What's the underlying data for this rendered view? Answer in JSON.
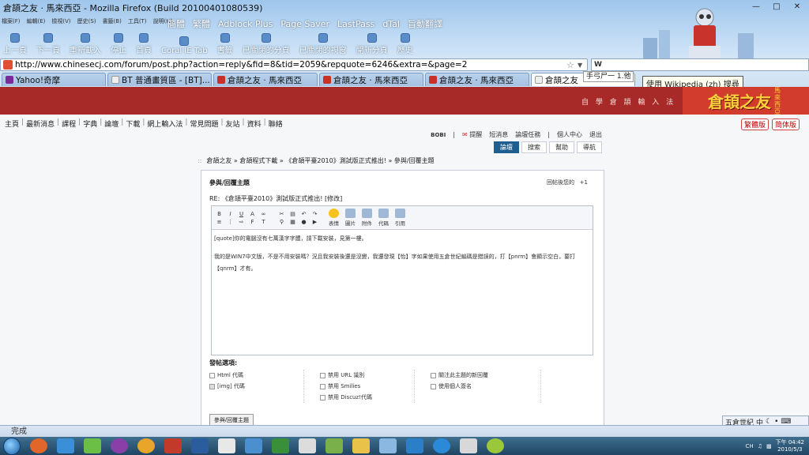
{
  "window": {
    "title": "倉頡之友 · 馬來西亞 - Mozilla Firefox (Build 20100401080539)"
  },
  "menubar": [
    "檔案(F)",
    "編輯(E)",
    "檢視(V)",
    "歷史(S)",
    "書籤(B)",
    "工具(T)",
    "說明(H)"
  ],
  "toolbar2": [
    "簡體",
    "繁體",
    "Adblock Plus",
    "Page Saver",
    "LastPass",
    "dTal",
    "旨動翻譯"
  ],
  "nav": {
    "back": "上一頁",
    "forward": "下一頁",
    "reload": "重新載入",
    "stop": "停止",
    "home": "首頁",
    "coral": "Coral IE Tab",
    "bookmarks": "書籤",
    "closed_tabs": "已關閉的分頁",
    "closed_windows": "已關閉的視窗",
    "new_tab": "開新分頁",
    "history": "歷史"
  },
  "url": "http://www.chinesecj.com/forum/post.php?action=reply&fid=8&tid=2059&repquote=6246&extra=&page=2",
  "search": {
    "value": "",
    "engine": "W",
    "suggest_text": "手弓尸一 1.他",
    "tooltip": "使用 Wikipedia (zh) 搜尋"
  },
  "tabs": [
    {
      "label": "Yahoo!奇摩",
      "icon": "yahoo"
    },
    {
      "label": "BT 普通畫質區 - [BT]...",
      "icon": "page"
    },
    {
      "label": "倉頡之友 · 馬來西亞",
      "icon": "cj"
    },
    {
      "label": "倉頡之友 · 馬來西亞",
      "icon": "cj"
    },
    {
      "label": "倉頡之友 · 馬來西亞",
      "icon": "cj"
    },
    {
      "label": "倉頡之友",
      "icon": "page",
      "active": true
    }
  ],
  "banner": {
    "slogan": "自 學 倉 頡 輸 入 法",
    "logo_main": "倉頡之友",
    "logo_sub": "馬來西亞"
  },
  "mainnav": [
    "主頁",
    "最新消息",
    "課程",
    "字典",
    "論壇",
    "下載",
    "網上輸入法",
    "常見問題",
    "友站",
    "資料",
    "聯絡"
  ],
  "versions": [
    "繁體版",
    "简体版"
  ],
  "userbar": {
    "user": "BOBI",
    "items": [
      "提醒",
      "短消息",
      "論壇任務",
      "個人中心",
      "退出"
    ]
  },
  "subtabs": [
    {
      "label": "論壇",
      "active": true
    },
    {
      "label": "搜索"
    },
    {
      "label": "幫助"
    },
    {
      "label": "導航"
    }
  ],
  "breadcrumb": "倉頡之友 » 倉頡程式下載 » 《倉頡平臺2010》測試版正式推出! » 參與/回覆主題",
  "post": {
    "heading": "參與/回覆主題",
    "reply_link": "回帖後您的",
    "reply_points": "+1",
    "subject": "RE: 《倉頡平臺2010》測試版正式推出!  [修改]",
    "editor_tools": [
      "表情",
      "圖片",
      "附件",
      "代碼",
      "引用"
    ],
    "body_line1": "[quote]你的電腦沒有七萬漢字字體，請下載安裝，見第一樓。",
    "body_line2": "我的是WIN7中文版，不是不用安裝嗎？況且我安裝後還是沒變，我還發現【怡】字如果使用五倉世紀編碼是錯誤的，打【pnrm】會顯示空白，要打【qnrm】才有。",
    "options_title": "發帖選項:",
    "options_col1": [
      "Html 代碼",
      "[img] 代碼"
    ],
    "options_col2": [
      "禁用 URL 識別",
      "禁用 Smilies",
      "禁用 Discuz!代碼"
    ],
    "options_col3": [
      "關注此主題的新回覆",
      "使用個人簽名"
    ],
    "submit": "參與/回覆主題"
  },
  "ime": {
    "label": "五倉世紀",
    "mode": "中"
  },
  "status": "完成",
  "taskbar": {
    "lang": "CH",
    "time": "下午 04:42",
    "date": "2010/5/3"
  }
}
